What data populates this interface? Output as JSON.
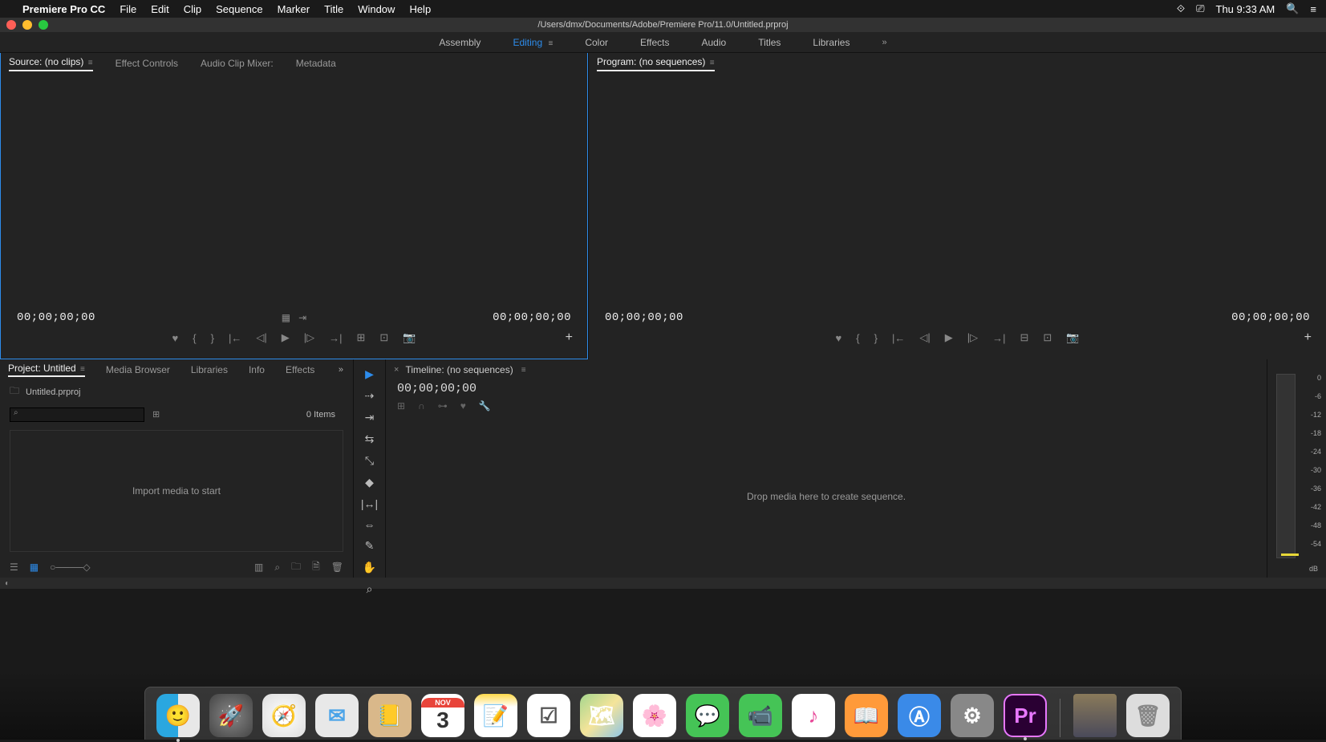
{
  "menubar": {
    "app_name": "Premiere Pro CC",
    "items": [
      "File",
      "Edit",
      "Clip",
      "Sequence",
      "Marker",
      "Title",
      "Window",
      "Help"
    ],
    "clock": "Thu 9:33 AM"
  },
  "window": {
    "path": "/Users/dmx/Documents/Adobe/Premiere Pro/11.0/Untitled.prproj"
  },
  "workspaces": {
    "items": [
      "Assembly",
      "Editing",
      "Color",
      "Effects",
      "Audio",
      "Titles",
      "Libraries"
    ],
    "active": "Editing"
  },
  "source_panel": {
    "tabs": [
      "Source: (no clips)",
      "Effect Controls",
      "Audio Clip Mixer:",
      "Metadata"
    ],
    "active_tab": "Source: (no clips)",
    "tc_left": "00;00;00;00",
    "tc_right": "00;00;00;00"
  },
  "program_panel": {
    "title": "Program: (no sequences)",
    "tc_left": "00;00;00;00",
    "tc_right": "00;00;00;00"
  },
  "project_panel": {
    "tabs": [
      "Project: Untitled",
      "Media Browser",
      "Libraries",
      "Info",
      "Effects"
    ],
    "active_tab": "Project: Untitled",
    "filename": "Untitled.prproj",
    "search_placeholder": "",
    "item_count": "0 Items",
    "drop_hint": "Import media to start"
  },
  "timeline_panel": {
    "title": "Timeline: (no sequences)",
    "tc": "00;00;00;00",
    "drop_hint": "Drop media here to create sequence."
  },
  "audio_meter": {
    "ticks": [
      "0",
      "-6",
      "-12",
      "-18",
      "-24",
      "-30",
      "-36",
      "-42",
      "-48",
      "-54"
    ],
    "unit": "dB"
  },
  "tools": [
    "selection",
    "track-select",
    "ripple",
    "rolling",
    "rate",
    "razor",
    "slip",
    "slide",
    "pen",
    "hand",
    "zoom"
  ],
  "dock": {
    "calendar_month": "NOV",
    "calendar_day": "3",
    "premiere_label": "Pr"
  }
}
